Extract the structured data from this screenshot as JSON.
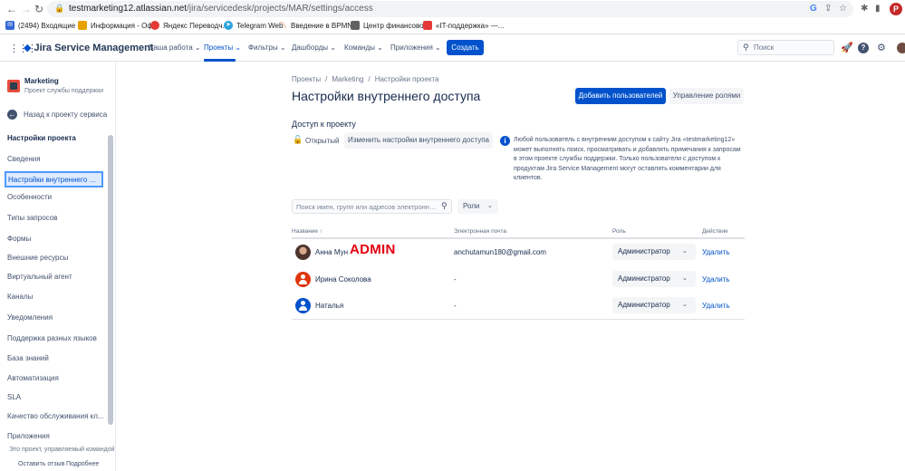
{
  "browser": {
    "url_host": "testmarketing12.atlassian.net",
    "url_path": "/jira/servicedesk/projects/MAR/settings/access",
    "profile_initial": "P",
    "bookmarks": [
      {
        "label": "(2494) Входящие -...",
        "color": "#3367d6"
      },
      {
        "label": "Информация - Оф...",
        "color": "#e6a100"
      },
      {
        "label": "Яндекс Переводч...",
        "color": "#e53935"
      },
      {
        "label": "Telegram Web",
        "color": "#2aa3df"
      },
      {
        "label": "Введение в BPMN...",
        "color": "#e64a19"
      },
      {
        "label": "Центр финансовог...",
        "color": "#616161"
      },
      {
        "label": "«IT-поддержка» —...",
        "color": "#e53935"
      }
    ]
  },
  "topnav": {
    "logo_text": "Jira Service Management",
    "items": [
      "Ваша работа",
      "Проекты",
      "Фильтры",
      "Дашборды",
      "Команды",
      "Приложения"
    ],
    "create_label": "Создать",
    "search_placeholder": "Поиск"
  },
  "sidebar": {
    "project_name": "Marketing",
    "project_type": "Проект службы поддержки",
    "back_label": "Назад к проекту сервиса",
    "section_title": "Настройки проекта",
    "items": [
      "Сведения",
      "Настройки внутреннего дос...",
      "Особенности",
      "Типы запросов",
      "Формы",
      "Внешние ресурсы",
      "Виртуальный агент",
      "Каналы",
      "Уведомления",
      "Поддержка разных языков",
      "База знаний",
      "Автоматизация",
      "SLA",
      "Качество обслуживания кл...",
      "Приложения"
    ],
    "footer_text": "Это проект, управляемый командой",
    "feedback_label": "Оставить отзыв",
    "more_label": "Подробнее"
  },
  "main": {
    "breadcrumb": [
      "Проекты",
      "/",
      "Marketing",
      "/",
      "Настройки проекта"
    ],
    "title": "Настройки внутреннего доступа",
    "add_users_label": "Добавить пользователей",
    "manage_roles_label": "Управление ролями",
    "access_title": "Доступ к проекту",
    "access_state": "Открытый",
    "change_access_label": "Изменить настройки внутреннего доступа",
    "info_text": "Любой пользователь с внутренним доступом к сайту Jira «testmarketing12» может выполнять поиск, просматривать и добавлять примечания к запросам в этом проекте службы поддержки. Только пользователи с доступом к продуктам Jira Service Management могут оставлять комментарии для клиентов.",
    "filter_placeholder": "Поиск имен, групп или адресов электронной почты",
    "roles_label": "Роли",
    "columns": {
      "name": "Название ↑",
      "email": "Электронная почта",
      "role": "Роль",
      "action": "Действие"
    },
    "rows": [
      {
        "name": "Анна Мун",
        "tag": "ADMIN",
        "email": "anchutamun180@gmail.com",
        "role": "Администратор",
        "action": "Удалить"
      },
      {
        "name": "Ирина Соколова",
        "tag": "",
        "email": "-",
        "role": "Администратор",
        "action": "Удалить"
      },
      {
        "name": "Наталья",
        "tag": "",
        "email": "-",
        "role": "Администратор",
        "action": "Удалить"
      }
    ]
  }
}
